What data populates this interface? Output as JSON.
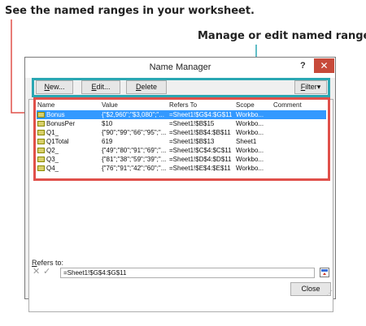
{
  "annotations": {
    "named_ranges": "See the named ranges in your worksheet.",
    "manage_edit": "Manage or edit named ranges."
  },
  "dialog": {
    "title": "Name Manager",
    "help_glyph": "?",
    "close_glyph": "✕"
  },
  "toolbar": {
    "new_label": "New...",
    "new_accel": "N",
    "new_rest": "ew...",
    "edit_label": "Edit...",
    "edit_accel": "E",
    "edit_rest": "dit...",
    "delete_label": "Delete",
    "delete_accel": "D",
    "delete_rest": "elete",
    "filter_label": "Filter",
    "filter_accel": "F",
    "filter_rest": "ilter",
    "filter_arrow": "▾"
  },
  "table": {
    "columns": [
      "Name",
      "Value",
      "Refers To",
      "Scope",
      "Comment"
    ],
    "rows": [
      {
        "name": "Bonus",
        "value": "{\"$2,960\";\"$3,080\";\"...",
        "refers_to": "=Sheet1!$G$4:$G$11",
        "scope": "Workbo...",
        "comment": "",
        "selected": true
      },
      {
        "name": "BonusPer",
        "value": "$10",
        "refers_to": "=Sheet1!$B$15",
        "scope": "Workbo...",
        "comment": "",
        "selected": false
      },
      {
        "name": "Q1_",
        "value": "{\"90\";\"99\";\"66\";\"95\";\"...",
        "refers_to": "=Sheet1!$B$4:$B$11",
        "scope": "Workbo...",
        "comment": "",
        "selected": false
      },
      {
        "name": "Q1Total",
        "value": "619",
        "refers_to": "=Sheet1!$B$13",
        "scope": "Sheet1",
        "comment": "",
        "selected": false
      },
      {
        "name": "Q2_",
        "value": "{\"49\";\"80\";\"91\";\"69\";\"...",
        "refers_to": "=Sheet1!$C$4:$C$11",
        "scope": "Workbo...",
        "comment": "",
        "selected": false
      },
      {
        "name": "Q3_",
        "value": "{\"81\";\"38\";\"59\";\"39\";\"...",
        "refers_to": "=Sheet1!$D$4:$D$11",
        "scope": "Workbo...",
        "comment": "",
        "selected": false
      },
      {
        "name": "Q4_",
        "value": "{\"76\";\"91\";\"42\";\"60\";\"...",
        "refers_to": "=Sheet1!$E$4:$E$11",
        "scope": "Workbo...",
        "comment": "",
        "selected": false
      }
    ]
  },
  "refers": {
    "label": "Refers to:",
    "label_accel": "R",
    "label_rest": "efers to:",
    "value": "=Sheet1!$G$4:$G$11",
    "cancel_glyph": "✕",
    "confirm_glyph": "✓"
  },
  "footer": {
    "close_label": "Close"
  },
  "colors": {
    "teal_highlight": "#2aa7b3",
    "red_highlight": "#e0504a",
    "selection": "#3399ff",
    "close_button": "#c74a3a"
  },
  "icons": {
    "range_icon": "named-range-icon",
    "collapse_icon": "range-collapse-icon"
  }
}
